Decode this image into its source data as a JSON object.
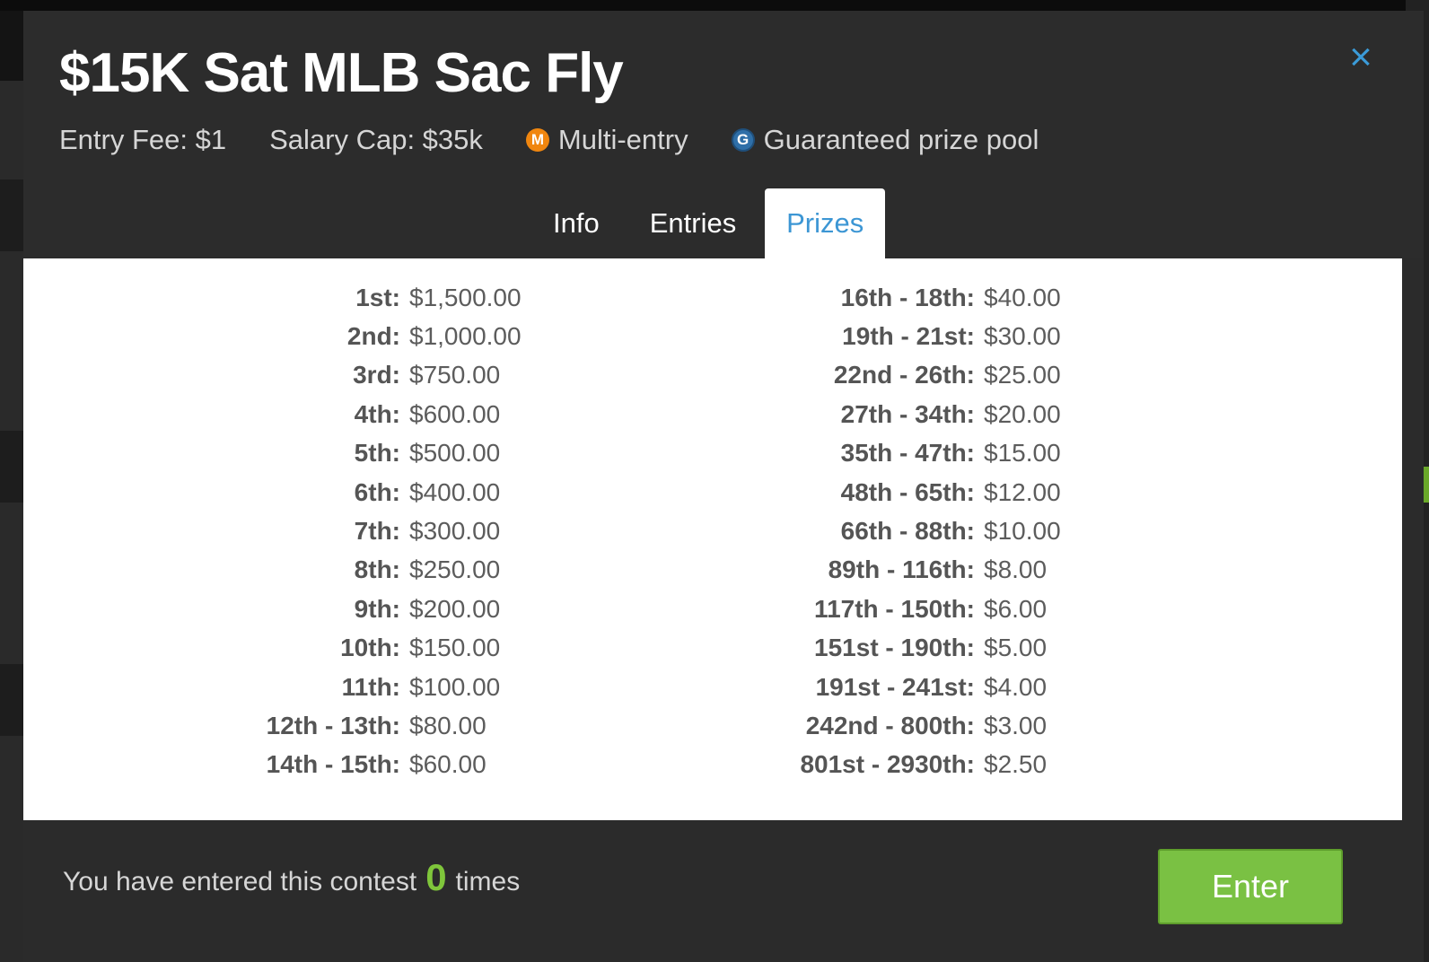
{
  "modal": {
    "title": "$15K Sat MLB Sac Fly",
    "close_icon": "×",
    "meta": {
      "entry_fee": "Entry Fee: $1",
      "salary_cap": "Salary Cap: $35k",
      "multi_entry_badge": "M",
      "multi_entry": "Multi-entry",
      "guaranteed_badge": "G",
      "guaranteed": "Guaranteed prize pool"
    },
    "tabs": [
      {
        "label": "Info"
      },
      {
        "label": "Entries"
      },
      {
        "label": "Prizes"
      }
    ],
    "active_tab": "Prizes",
    "prizes_left": [
      {
        "rank": "1st:",
        "amount": "$1,500.00"
      },
      {
        "rank": "2nd:",
        "amount": "$1,000.00"
      },
      {
        "rank": "3rd:",
        "amount": "$750.00"
      },
      {
        "rank": "4th:",
        "amount": "$600.00"
      },
      {
        "rank": "5th:",
        "amount": "$500.00"
      },
      {
        "rank": "6th:",
        "amount": "$400.00"
      },
      {
        "rank": "7th:",
        "amount": "$300.00"
      },
      {
        "rank": "8th:",
        "amount": "$250.00"
      },
      {
        "rank": "9th:",
        "amount": "$200.00"
      },
      {
        "rank": "10th:",
        "amount": "$150.00"
      },
      {
        "rank": "11th:",
        "amount": "$100.00"
      },
      {
        "rank": "12th - 13th:",
        "amount": "$80.00"
      },
      {
        "rank": "14th - 15th:",
        "amount": "$60.00"
      }
    ],
    "prizes_right": [
      {
        "rank": "16th - 18th:",
        "amount": "$40.00"
      },
      {
        "rank": "19th - 21st:",
        "amount": "$30.00"
      },
      {
        "rank": "22nd - 26th:",
        "amount": "$25.00"
      },
      {
        "rank": "27th - 34th:",
        "amount": "$20.00"
      },
      {
        "rank": "35th - 47th:",
        "amount": "$15.00"
      },
      {
        "rank": "48th - 65th:",
        "amount": "$12.00"
      },
      {
        "rank": "66th - 88th:",
        "amount": "$10.00"
      },
      {
        "rank": "89th - 116th:",
        "amount": "$8.00"
      },
      {
        "rank": "117th - 150th:",
        "amount": "$6.00"
      },
      {
        "rank": "151st - 190th:",
        "amount": "$5.00"
      },
      {
        "rank": "191st - 241st:",
        "amount": "$4.00"
      },
      {
        "rank": "242nd - 800th:",
        "amount": "$3.00"
      },
      {
        "rank": "801st - 2930th:",
        "amount": "$2.50"
      }
    ],
    "footer": {
      "entered_prefix": "You have entered this contest",
      "entered_count": "0",
      "entered_suffix": "times",
      "enter_label": "Enter"
    }
  },
  "colors": {
    "accent_blue": "#3c96d4",
    "enter_green": "#7ac143",
    "count_green": "#7fc63b",
    "multi_entry_orange": "#f0860f",
    "guaranteed_blue": "#2f6fa8"
  }
}
